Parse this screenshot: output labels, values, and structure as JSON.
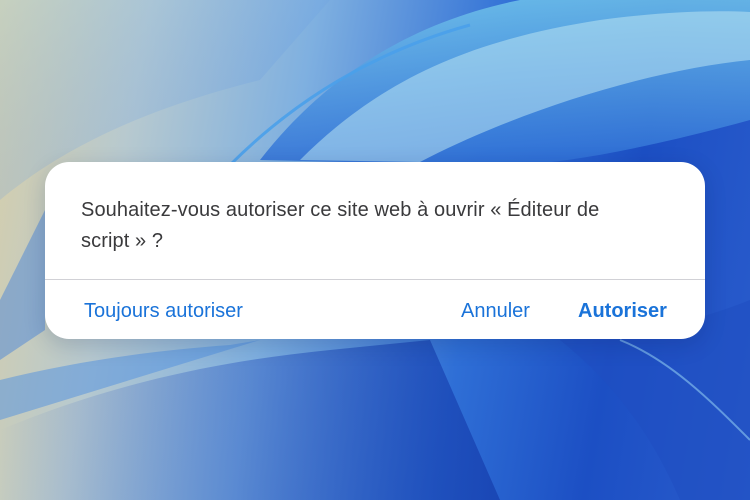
{
  "wallpaper": {
    "colors": [
      "#d9cfa8",
      "#7fb0e0",
      "#2f6fd6",
      "#1c4fc4"
    ]
  },
  "dialog": {
    "message_line1": "Souhaitez-vous autoriser ce site web à ouvrir « Éditeur de",
    "message_line2": "script » ?",
    "buttons": {
      "always_allow": "Toujours autoriser",
      "cancel": "Annuler",
      "allow": "Autoriser"
    },
    "accent_color": "#1a73d9"
  }
}
